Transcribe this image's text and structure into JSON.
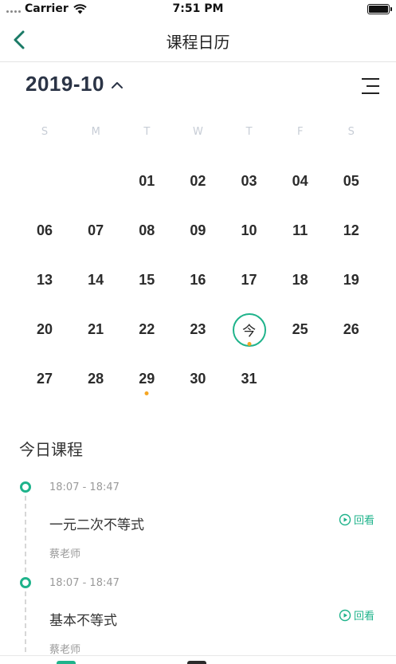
{
  "status_bar": {
    "carrier": "Carrier",
    "time": "7:51 PM"
  },
  "nav": {
    "title": "课程日历",
    "back_icon": "chevron-left-icon"
  },
  "calendar": {
    "month_label": "2019-10",
    "weekdays": [
      "S",
      "M",
      "T",
      "W",
      "T",
      "F",
      "S"
    ],
    "leading_blanks": 2,
    "days": [
      "01",
      "02",
      "03",
      "04",
      "05",
      "06",
      "07",
      "08",
      "09",
      "10",
      "11",
      "12",
      "13",
      "14",
      "15",
      "16",
      "17",
      "18",
      "19",
      "20",
      "21",
      "22",
      "23",
      "今",
      "25",
      "26",
      "27",
      "28",
      "29",
      "30",
      "31"
    ],
    "today_index": 23,
    "dot_indices": [
      23,
      28
    ],
    "accent_color": "#1fb38b",
    "dot_color": "#f5a623"
  },
  "today": {
    "section_title": "今日课程",
    "courses": [
      {
        "time": "18:07 - 18:47",
        "name": "一元二次不等式",
        "teacher": "蔡老师",
        "action_label": "回看"
      },
      {
        "time": "18:07 - 18:47",
        "name": "基本不等式",
        "teacher": "蔡老师",
        "action_label": "回看"
      }
    ]
  }
}
